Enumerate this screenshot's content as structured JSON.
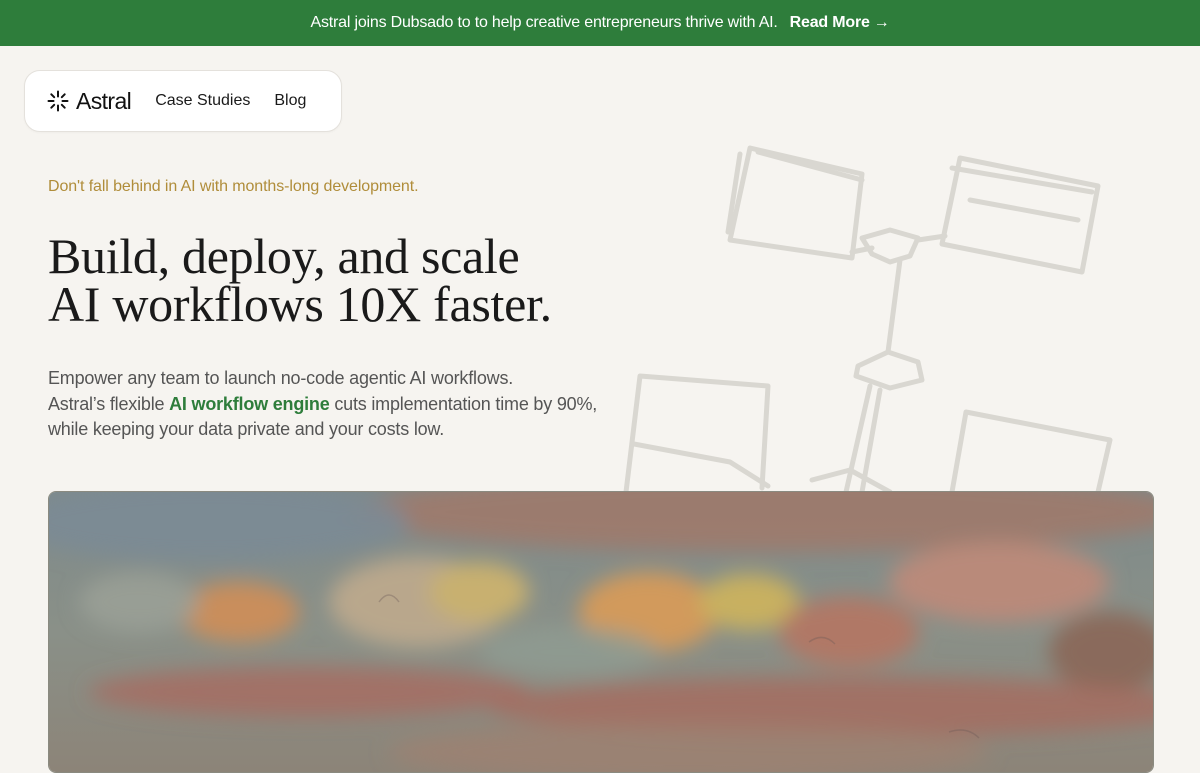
{
  "banner": {
    "message": "Astral joins Dubsado to to help creative entrepreneurs thrive with AI.",
    "link_label": "Read More",
    "arrow_icon": "→"
  },
  "nav": {
    "brand": "Astral",
    "links": [
      "Case Studies",
      "Blog"
    ]
  },
  "hero": {
    "eyebrow": "Don't fall behind in AI with months-long development.",
    "headline_line1": "Build, deploy, and scale",
    "headline_line2": "AI workflows 10X faster.",
    "subtext_line1": "Empower any team to launch no-code agentic AI workflows.",
    "subtext_line2_pre": "Astral’s flexible ",
    "subtext_link": "AI workflow engine",
    "subtext_line2_post": " cuts implementation time by 90%,",
    "subtext_line3": "while keeping your data private and your costs low."
  },
  "colors": {
    "banner_bg": "#2e7d3b",
    "accent_gold": "#b08d3a",
    "link_green": "#2e7d3b",
    "page_bg": "#f6f4f0"
  }
}
